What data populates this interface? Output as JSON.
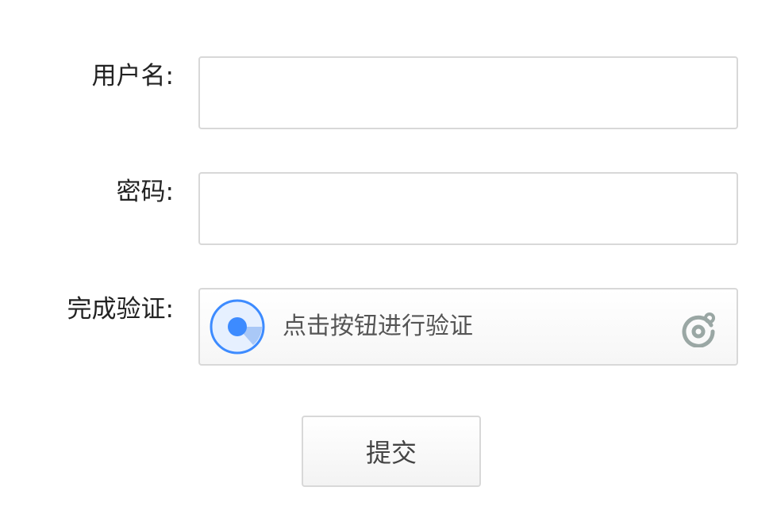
{
  "form": {
    "username": {
      "label": "用户名:",
      "value": "",
      "placeholder": ""
    },
    "password": {
      "label": "密码:",
      "value": "",
      "placeholder": ""
    },
    "verification": {
      "label": "完成验证:",
      "button_text": "点击按钮进行验证",
      "radar_icon": "radar-icon",
      "logo_icon": "geetest-logo-icon"
    },
    "submit_label": "提交"
  },
  "colors": {
    "accent_blue": "#3d8bff",
    "radar_bg": "#e6f0ff",
    "border": "#d8d8d8",
    "logo_gray": "#9aa7a4"
  }
}
